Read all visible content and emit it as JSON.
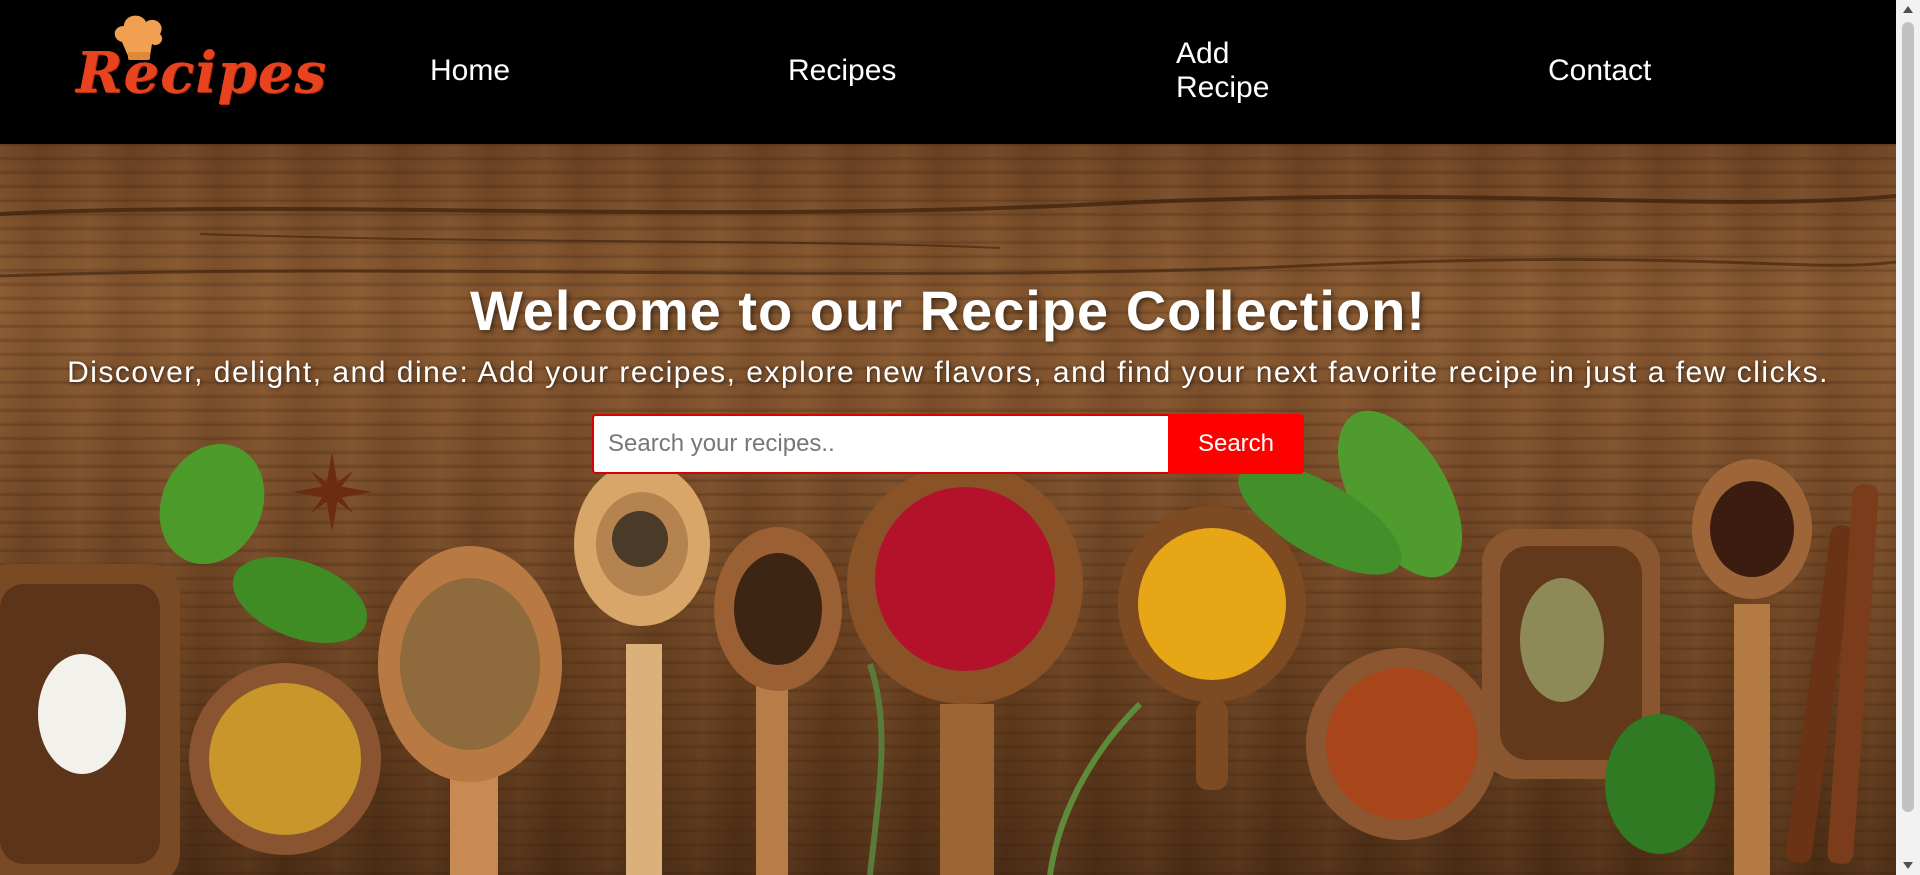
{
  "header": {
    "logo_text": "Recipes",
    "nav": [
      {
        "label": "Home"
      },
      {
        "label": "Recipes"
      },
      {
        "label": "Add Recipe"
      },
      {
        "label": "Contact"
      }
    ]
  },
  "hero": {
    "title": "Welcome to our Recipe Collection!",
    "subtitle": "Discover, delight, and dine: Add your recipes, explore new flavors, and find your next favorite recipe in just a few clicks.",
    "search": {
      "placeholder": "Search your recipes..",
      "value": "",
      "button_label": "Search"
    }
  },
  "colors": {
    "header_bg": "#000000",
    "logo": "#e8431f",
    "search_button": "#ff0000",
    "search_border": "#d90000"
  },
  "icons": [
    "chef-hat-icon",
    "scroll-up-arrow-icon",
    "scroll-down-arrow-icon"
  ]
}
